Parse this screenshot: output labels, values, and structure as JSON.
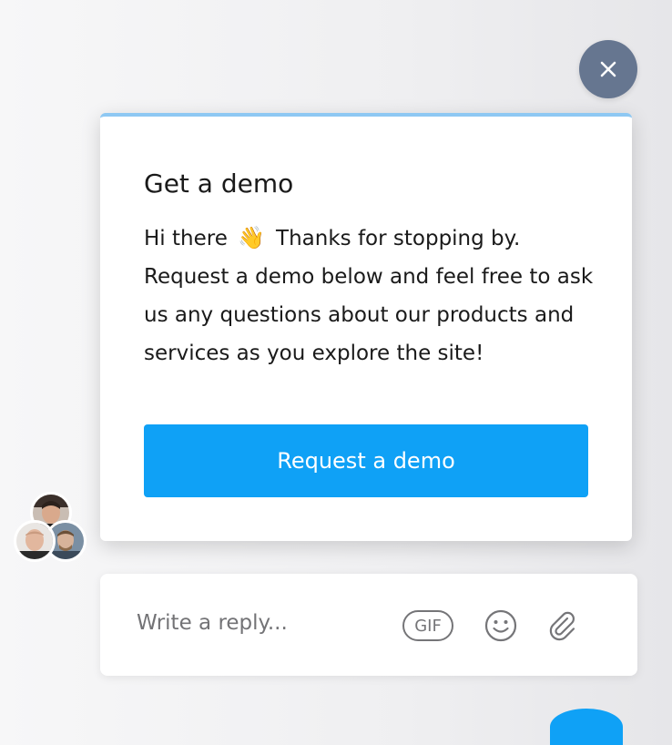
{
  "card": {
    "title": "Get a demo",
    "greeting": "Hi there",
    "wave_emoji": "👋",
    "message": "Thanks for stopping by. Request a demo below and feel free to ask us any questions about our products and services as you explore the site!",
    "cta_label": "Request a demo"
  },
  "reply": {
    "placeholder": "Write a reply...",
    "gif_label": "GIF"
  },
  "icons": {
    "close": "close-icon",
    "emoji": "smiley-icon",
    "attach": "paperclip-icon"
  },
  "colors": {
    "accent": "#0fa1f6",
    "card_top_border": "#8ec8f3",
    "close_button": "#667690"
  }
}
